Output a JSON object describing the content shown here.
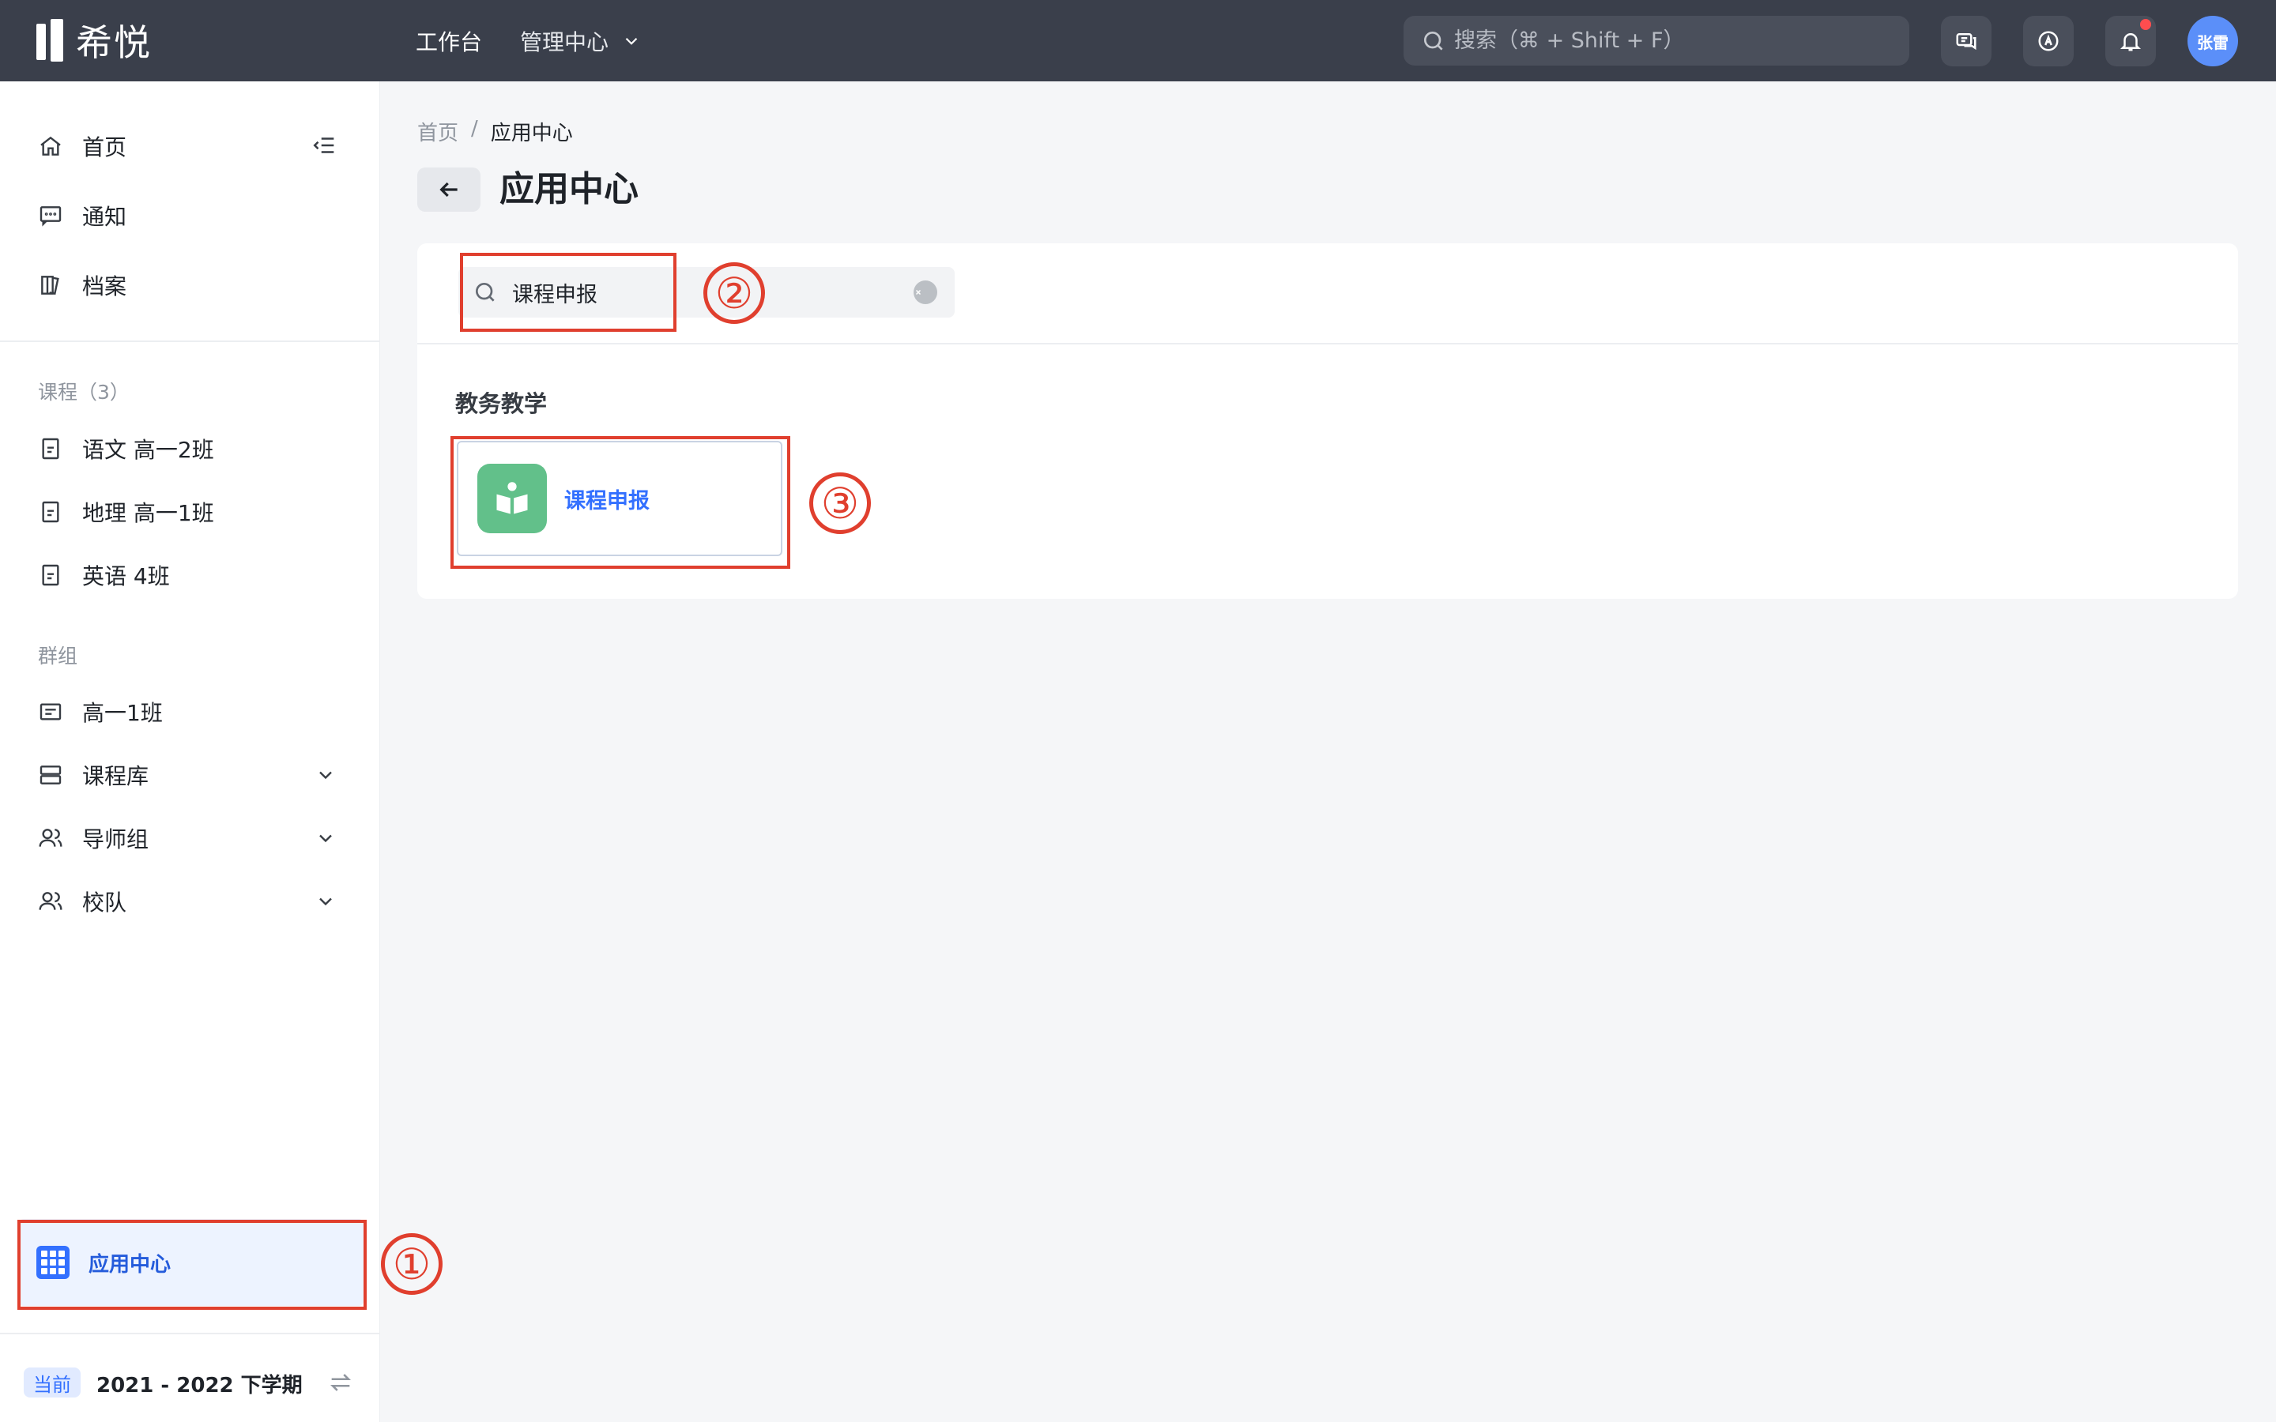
{
  "topbar": {
    "logo": "希悦",
    "nav": [
      {
        "label": "工作台"
      },
      {
        "label": "管理中心"
      }
    ],
    "search_placeholder": "搜索（⌘ + Shift + F）",
    "avatar": "张雷"
  },
  "sidebar": {
    "main_items": [
      {
        "label": "首页",
        "icon": "home-icon"
      },
      {
        "label": "通知",
        "icon": "message-icon"
      },
      {
        "label": "档案",
        "icon": "archive-icon"
      }
    ],
    "courses_label": "课程（3）",
    "courses": [
      {
        "label": "语文 高一2班"
      },
      {
        "label": "地理 高一1班"
      },
      {
        "label": "英语 4班"
      }
    ],
    "groups_label": "群组",
    "groups": [
      {
        "label": "高一1班"
      },
      {
        "label": "课程库"
      },
      {
        "label": "导师组"
      },
      {
        "label": "校队"
      }
    ],
    "app_center": "应用中心",
    "term_badge": "当前",
    "term": "2021 - 2022 下学期"
  },
  "main": {
    "breadcrumb": [
      "首页",
      "/",
      "应用中心"
    ],
    "title": "应用中心",
    "search_value": "课程申报",
    "section_title": "教务教学",
    "apps": [
      {
        "name": "课程申报",
        "icon": "book-reader-icon",
        "color": "#62c08a"
      }
    ]
  },
  "annotations": [
    "①",
    "②",
    "③"
  ],
  "colors": {
    "topbar": "#3a3f4b",
    "accent": "#3370ff",
    "annotation": "#e03f2e",
    "app_icon": "#62c08a"
  }
}
